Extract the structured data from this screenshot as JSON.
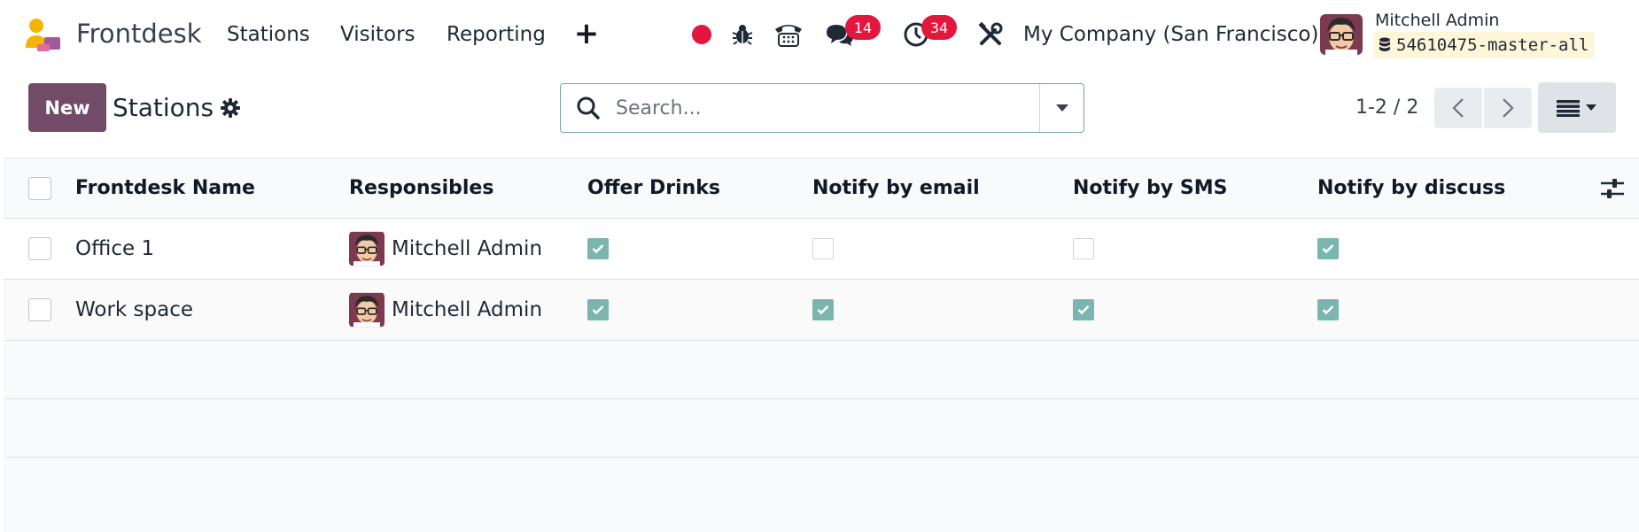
{
  "navbar": {
    "app_name": "Frontdesk",
    "menu": [
      {
        "label": "Stations"
      },
      {
        "label": "Visitors"
      },
      {
        "label": "Reporting"
      }
    ],
    "add_icon_glyph": "+",
    "messages_badge": "14",
    "activities_badge": "34",
    "company": "My Company (San Francisco)",
    "user_name": "Mitchell Admin",
    "database": "54610475-master-all",
    "status_color": "#e3173e"
  },
  "control_panel": {
    "new_label": "New",
    "title": "Stations",
    "search_placeholder": "Search...",
    "pager_value": "1-2 / 2"
  },
  "table": {
    "columns": [
      {
        "label": "Frontdesk Name"
      },
      {
        "label": "Responsibles"
      },
      {
        "label": "Offer Drinks"
      },
      {
        "label": "Notify by email"
      },
      {
        "label": "Notify by SMS"
      },
      {
        "label": "Notify by discuss"
      }
    ],
    "rows": [
      {
        "name": "Office 1",
        "responsible": "Mitchell Admin",
        "offer_drinks": true,
        "notify_email": false,
        "notify_sms": false,
        "notify_discuss": true
      },
      {
        "name": "Work space",
        "responsible": "Mitchell Admin",
        "offer_drinks": true,
        "notify_email": true,
        "notify_sms": true,
        "notify_discuss": true
      }
    ]
  },
  "colors": {
    "brand": "#714b67",
    "checkbox_checked": "#7ab5b0",
    "search_border": "#6ea89f",
    "badge": "#e3173e"
  }
}
